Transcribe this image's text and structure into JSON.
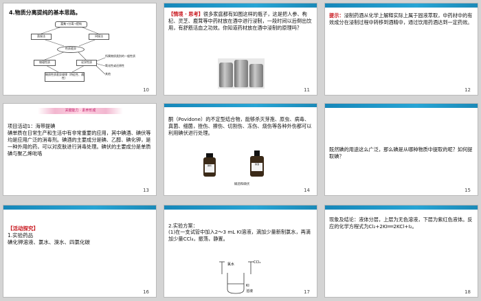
{
  "slides": [
    {
      "num": "10",
      "title": "4.物质分离提纯的基本思路。",
      "diagram": {
        "top": "富集→分离→提纯",
        "left": "直接法",
        "right": "间接法",
        "center": "性质差异",
        "bl": "物理性质",
        "bm": "化学性质",
        "bottom": "物质性质差异规律（特征性、通性）",
        "side1": "所属物质类别的一般性质",
        "side2": "氧化性或还原性",
        "side3": "其他"
      }
    },
    {
      "num": "11",
      "tag": "【情境 · 思考】",
      "body": "很多家庭都有如图这样的瓶子，这是把人参、枸杞、灵芝、鹿茸等中药材放在酒中进行浸制，一段时间以后倒出饮用，有舒筋活血之功效。你知道药材放在酒中浸制的原理吗？"
    },
    {
      "num": "12",
      "tag": "提示：",
      "body": "浸制药酒从化学上解释实际上属于固液萃取，中药材中的有效成分在浸制过程中转移到酒精中，通过饮用药酒达到一定药效。"
    },
    {
      "num": "13",
      "banner": "关键能力 · 素养形成",
      "body": "项目活动1：海带提碘\n碘单质在日常生产和生活中有非常重要的应用，其中碘酒、碘伏等均是应用广泛的消毒剂。碘酒的主要成分是碘、乙醇、碘化钾，是一种外用的药，可以对皮肤进行消毒处理。碘伏的主要成分是单质碘与聚乙烯吡咯"
    },
    {
      "num": "14",
      "body": "酮（Povidone）的不定型结合物，能够杀灭芽孢、原虫、病毒、真菌、细菌，挫伤、擦伤、切割伤、冻伤、烧伤等各种外伤都可以利用碘伏进行处理。",
      "caption": "碘酒和碘伏",
      "bottle1": "碘伏",
      "bottle2": "碘酒"
    },
    {
      "num": "15",
      "body": "既然碘的用途这么广泛，那么碘是从哪种物质中提取的呢？如何提取碘？"
    },
    {
      "num": "16",
      "tag": "【活动探究】",
      "l1": "1.实验药品",
      "l2": "碘化钾溶液、氯水、溴水、四氯化碳"
    },
    {
      "num": "17",
      "l1": "2.实验方案：",
      "l2": "(1)在一支试管中加入2～3 mL KI溶液，滴加少量新制氯水，再滴加少量CCl₄，振荡，静置。",
      "fig": {
        "a": "氯水",
        "b": "CCl₄",
        "c": "KI",
        "d": "溶液"
      }
    },
    {
      "num": "18",
      "body": "现象及结论：液体分层，上层为无色溶液，下层为紫红色液体。反应的化学方程式为Cl₂+2KI══2KCl+I₂。"
    }
  ]
}
